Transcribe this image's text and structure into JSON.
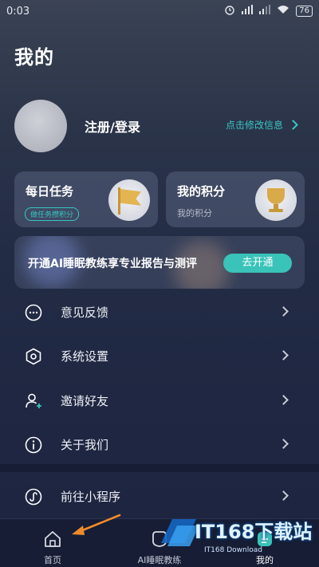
{
  "status_bar": {
    "time": "0:03",
    "battery": "76"
  },
  "page": {
    "title": "我的"
  },
  "profile": {
    "login_label": "注册/登录",
    "edit_label": "点击修改信息"
  },
  "cards": [
    {
      "title": "每日任务",
      "sub": "做任务攒积分"
    },
    {
      "title": "我的积分",
      "sub": "我的积分"
    }
  ],
  "banner": {
    "text": "开通AI睡眠教练享专业报告与测评",
    "button": "去开通"
  },
  "menu": [
    {
      "label": "意见反馈",
      "icon": "chat-bubble-icon"
    },
    {
      "label": "系统设置",
      "icon": "hexagon-settings-icon"
    },
    {
      "label": "邀请好友",
      "icon": "add-user-icon"
    },
    {
      "label": "关于我们",
      "icon": "info-icon"
    },
    {
      "label": "前往小程序",
      "icon": "mini-program-icon"
    }
  ],
  "tabs": [
    {
      "label": "首页",
      "icon": "home-icon"
    },
    {
      "label": "AI睡眠教练",
      "icon": "ai-coach-icon"
    },
    {
      "label": "我的",
      "icon": "profile-icon"
    }
  ],
  "watermark": {
    "brand": "IT168下载站",
    "sub": "IT168 Download"
  },
  "colors": {
    "accent": "#39c3b9",
    "background": "#1f2742",
    "tabbar": "#161d34"
  }
}
